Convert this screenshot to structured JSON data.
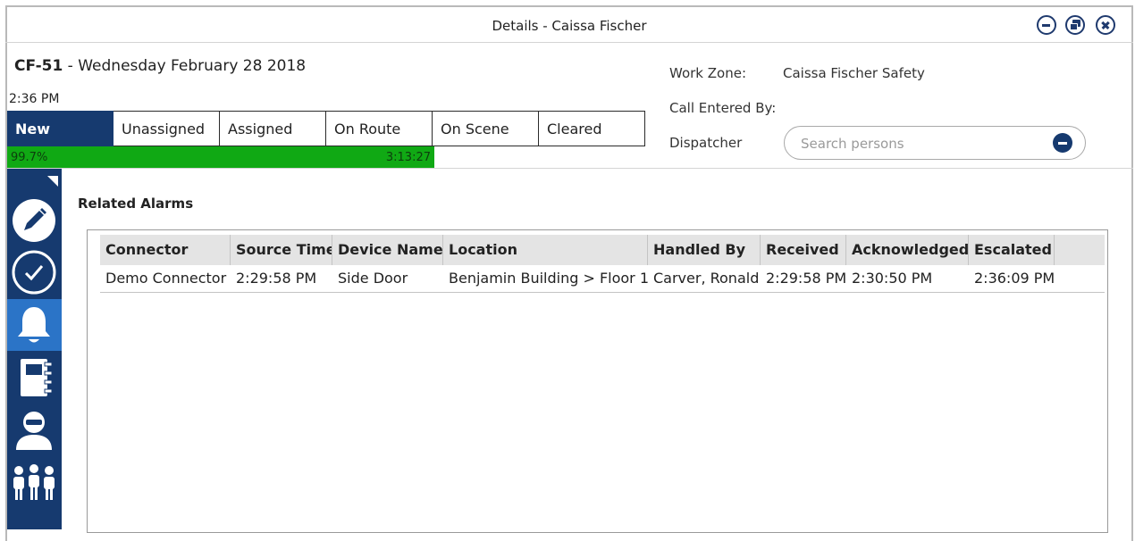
{
  "window": {
    "title": "Details - Caissa Fischer"
  },
  "call": {
    "id": "CF-51",
    "separator": " - ",
    "date": "Wednesday February 28 2018",
    "time": "2:36 PM"
  },
  "status_tabs": [
    {
      "label": "New",
      "active": true
    },
    {
      "label": "Unassigned"
    },
    {
      "label": "Assigned"
    },
    {
      "label": "On Route"
    },
    {
      "label": "On Scene"
    },
    {
      "label": "Cleared"
    }
  ],
  "progress": {
    "percent_label": "99.7%",
    "elapsed": "3:13:27",
    "color": "#10a914"
  },
  "fields": {
    "work_zone_label": "Work Zone:",
    "work_zone_value": "Caissa Fischer Safety",
    "call_entered_by_label": "Call Entered By:",
    "dispatcher_label": "Dispatcher"
  },
  "search": {
    "placeholder": "Search persons",
    "value": ""
  },
  "sidebar": {
    "items": [
      {
        "icon": "pencil-icon"
      },
      {
        "icon": "checkmark-icon"
      },
      {
        "icon": "bell-icon",
        "active": true
      },
      {
        "icon": "notebook-icon"
      },
      {
        "icon": "person-icon"
      },
      {
        "icon": "people-group-icon"
      }
    ]
  },
  "related_alarms": {
    "title": "Related Alarms",
    "columns": [
      "Connector",
      "Source Time",
      "Device Name",
      "Location",
      "Handled By",
      "Received",
      "Acknowledged",
      "Escalated"
    ],
    "rows": [
      [
        "Demo Connector",
        "2:29:58 PM",
        "Side Door",
        "Benjamin Building > Floor 1",
        "Carver, Ronald",
        "2:29:58 PM",
        "2:30:50 PM",
        "2:36:09 PM"
      ]
    ]
  },
  "colors": {
    "primary": "#163a6f",
    "nav_active": "#2b74c7",
    "progress": "#10a914",
    "grid_header": "#e4e4e4"
  }
}
